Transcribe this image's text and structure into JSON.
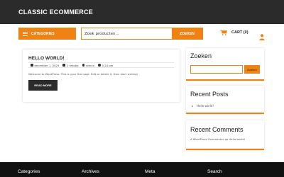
{
  "header": {
    "site_title": "CLASSIC ECOMMERCE"
  },
  "navbar": {
    "categories_label": "CATEGORIES",
    "search_placeholder": "Zoek producten...",
    "search_button": "ZOEKEN",
    "cart_label": "CART (0)"
  },
  "post": {
    "title": "HELLO WORLD!",
    "date": "december 1, 2025",
    "comments": "1 reactie",
    "author": "admin",
    "time": "5:24 pm",
    "excerpt": "Welcome to WordPress. This is your first post. Edit or delete it, then start writing!",
    "read_more": "READ MORE"
  },
  "sidebar": {
    "search_title": "Zoeken",
    "search_button": "Zoeken",
    "recent_posts_title": "Recent Posts",
    "recent_posts": [
      "Hello world!"
    ],
    "recent_comments_title": "Recent Comments",
    "recent_comment_author": "A WordPress Commenter",
    "recent_comment_sep": "op",
    "recent_comment_post": "Hello world!"
  },
  "footer": {
    "columns": [
      "Categories",
      "Archives",
      "Meta",
      "Search"
    ]
  },
  "colors": {
    "accent": "#f08214",
    "topbar": "#2b2b2b",
    "footer": "#111111"
  }
}
